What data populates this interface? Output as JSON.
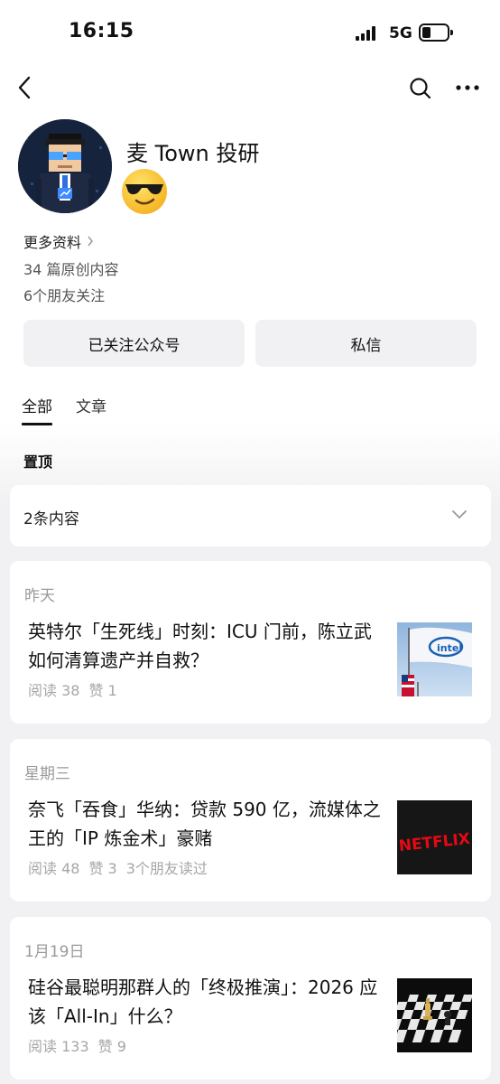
{
  "status": {
    "time": "16:15",
    "network": "5G"
  },
  "nav": {
    "back_icon": "chevron-left-icon",
    "search_icon": "search-icon",
    "more_icon": "more-horizontal-icon"
  },
  "profile": {
    "name": "麦 Town 投研",
    "more_info": "更多资料",
    "original_count": "34 篇原创内容",
    "friends_following": "6个朋友关注"
  },
  "actions": {
    "followed": "已关注公众号",
    "message": "私信"
  },
  "tabs": [
    {
      "label": "全部",
      "active": true
    },
    {
      "label": "文章",
      "active": false
    }
  ],
  "pinned": {
    "title": "置顶",
    "summary": "2条内容"
  },
  "articles": [
    {
      "date": "昨天",
      "title": "英特尔「生死线」时刻：ICU 门前，陈立武如何清算遗产并自救？",
      "reads": "阅读 38",
      "likes": "赞 1",
      "friends": ""
    },
    {
      "date": "星期三",
      "title": "奈飞「吞食」华纳：贷款 590 亿，流媒体之王的「IP 炼金术」豪赌",
      "reads": "阅读 48",
      "likes": "赞 3",
      "friends": "3个朋友读过"
    },
    {
      "date": "1月19日",
      "title": "硅谷最聪明那群人的「终极推演」：2026 应该「All-In」什么？",
      "reads": "阅读 133",
      "likes": "赞 9",
      "friends": ""
    }
  ],
  "thumbnails": {
    "netflix_logo": "NETFLIX"
  }
}
